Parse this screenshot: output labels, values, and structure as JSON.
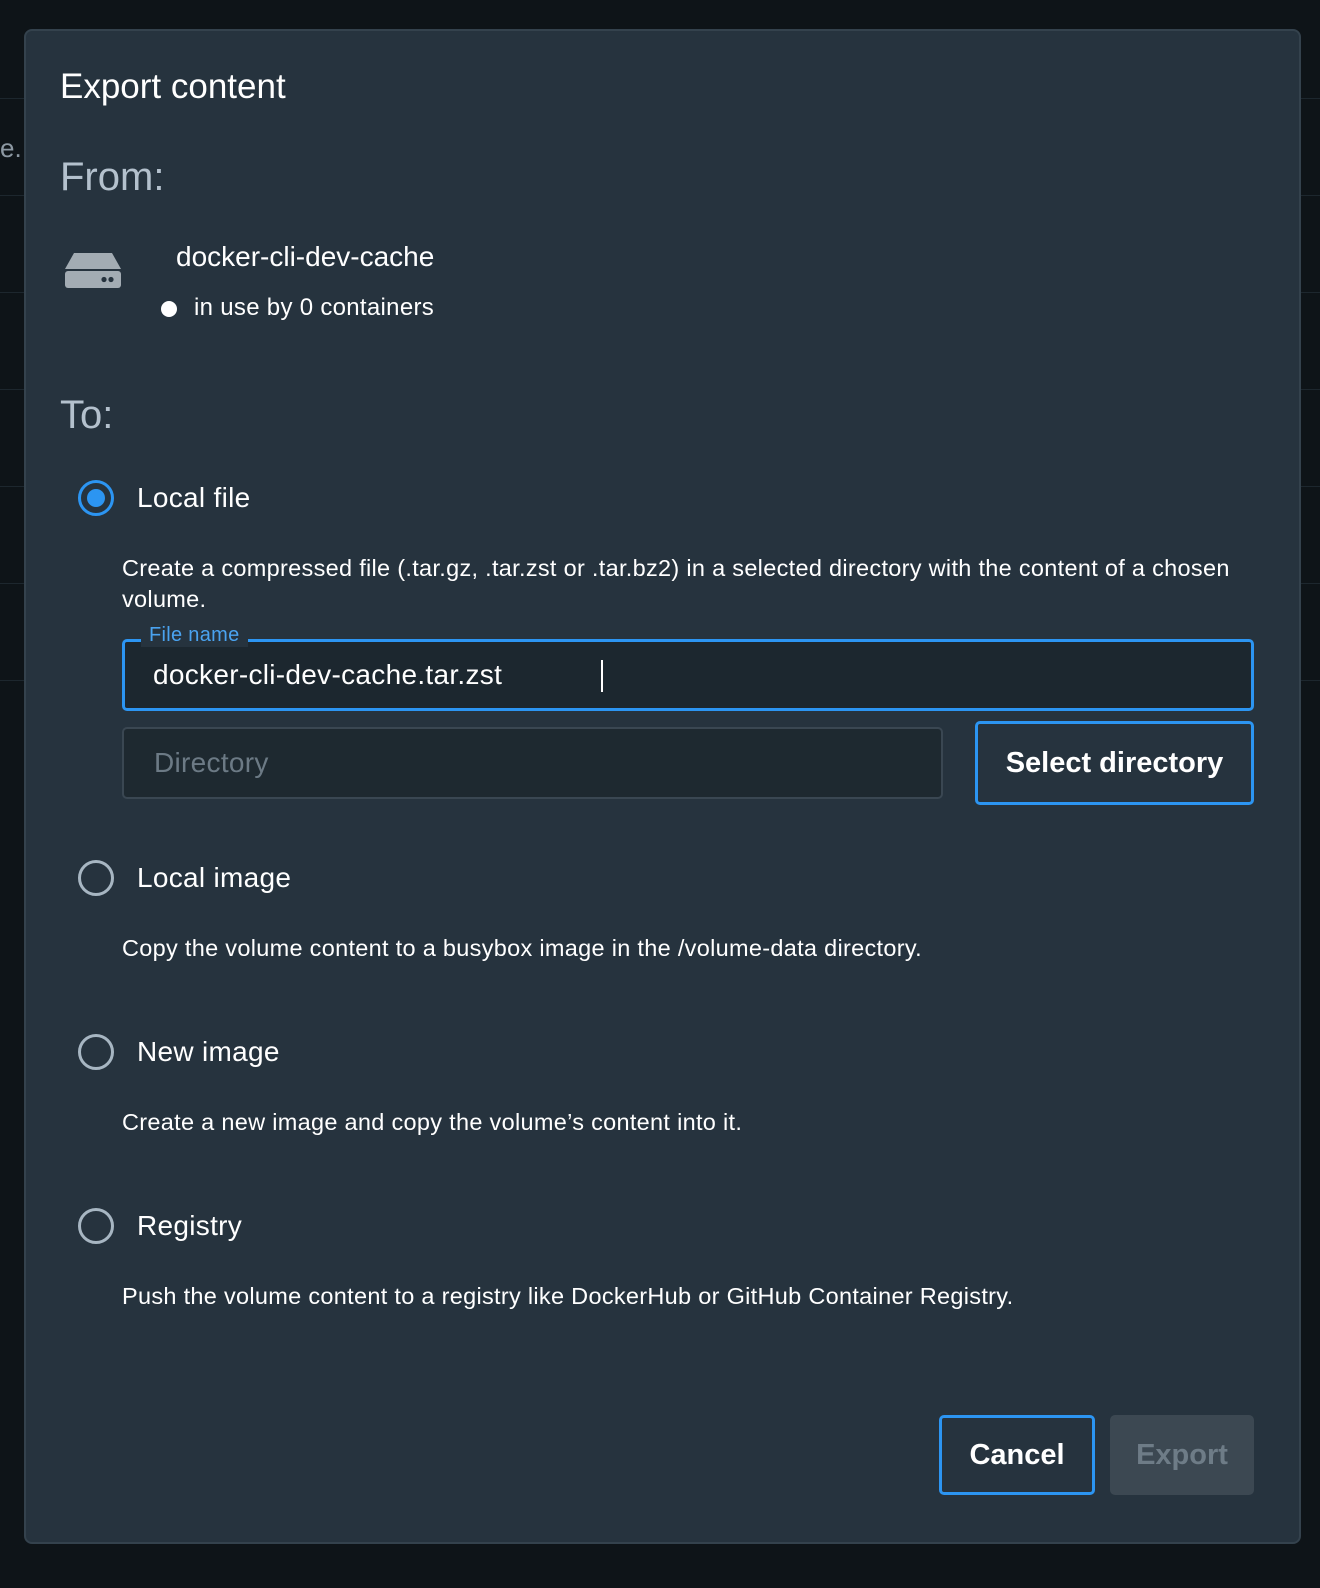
{
  "background": {
    "partial_text": "e."
  },
  "dialog": {
    "title": "Export content",
    "from_heading": "From:",
    "to_heading": "To:",
    "source": {
      "icon": "hard-drive-icon",
      "volume_name": "docker-cli-dev-cache",
      "status_text": "in use by 0 containers"
    },
    "options": [
      {
        "label": "Local file",
        "selected": true,
        "description": "Create a compressed file (.tar.gz, .tar.zst or .tar.bz2) in a selected directory with the content of a chosen volume."
      },
      {
        "label": "Local image",
        "selected": false,
        "description": "Copy the volume content to a busybox image in the /volume-data directory."
      },
      {
        "label": "New image",
        "selected": false,
        "description": "Create a new image and copy the volume’s content into it."
      },
      {
        "label": "Registry",
        "selected": false,
        "description": "Push the volume content to a registry like DockerHub or GitHub Container Registry."
      }
    ],
    "file_name": {
      "label": "File name",
      "value": "docker-cli-dev-cache.tar.zst"
    },
    "directory": {
      "placeholder": "Directory",
      "value": ""
    },
    "select_directory_label": "Select directory",
    "cancel_label": "Cancel",
    "export_label": "Export"
  },
  "colors": {
    "accent": "#2c95f2",
    "dialog_bg": "#26333e",
    "page_bg": "#0e1418",
    "disabled_button": "#3c4852"
  }
}
